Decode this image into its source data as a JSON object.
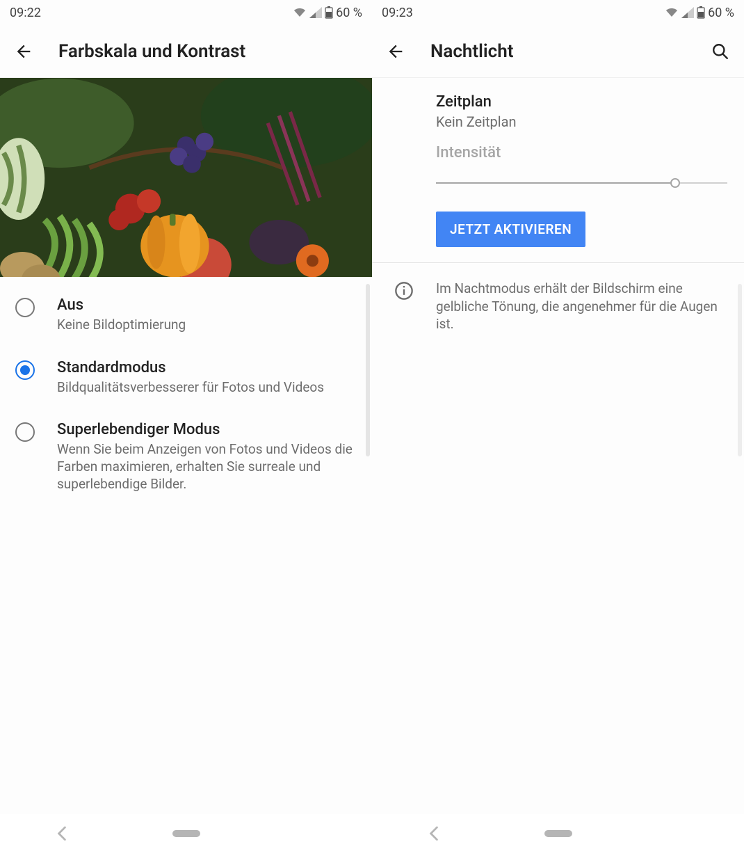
{
  "left": {
    "status": {
      "time": "09:22",
      "battery": "60 %"
    },
    "title": "Farbskala und Kontrast",
    "options": [
      {
        "title": "Aus",
        "desc": "Keine Bildoptimierung",
        "selected": false
      },
      {
        "title": "Standardmodus",
        "desc": "Bildqualitätsverbesserer für Fotos und Videos",
        "selected": true
      },
      {
        "title": "Superlebendiger Modus",
        "desc": "Wenn Sie beim Anzeigen von Fotos und Videos die Farben maximieren, erhalten Sie surreale und superlebendige Bilder.",
        "selected": false
      }
    ]
  },
  "right": {
    "status": {
      "time": "09:23",
      "battery": "60 %"
    },
    "title": "Nachtlicht",
    "schedule": {
      "title": "Zeitplan",
      "value": "Kein Zeitplan"
    },
    "intensity": {
      "label": "Intensität",
      "value_percent": 82
    },
    "activate_button": "JETZT AKTIVIEREN",
    "info_text": "Im Nachtmodus erhält der Bildschirm eine gelbliche Tönung, die angenehmer für die Augen ist."
  },
  "icons": {
    "back": "back-arrow-icon",
    "search": "search-icon",
    "wifi": "wifi-icon",
    "signal": "cell-signal-icon",
    "battery": "battery-icon",
    "info": "info-icon"
  },
  "colors": {
    "accent": "#4285f4",
    "radio_selected": "#1a73e8",
    "text_primary": "#222222",
    "text_secondary": "#6d6d6d",
    "text_disabled": "#a6a6a6"
  }
}
